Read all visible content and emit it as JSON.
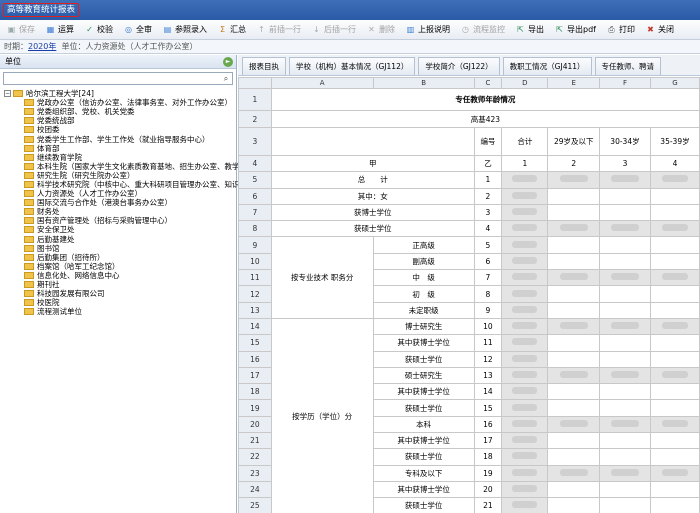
{
  "window": {
    "title": "高等教育统计报表"
  },
  "toolbar": {
    "buttons": [
      {
        "label": "保存",
        "icon": "save-icon",
        "disabled": true
      },
      {
        "label": "运算",
        "icon": "calculate-icon",
        "disabled": false
      },
      {
        "label": "校验",
        "icon": "check-icon",
        "disabled": false
      },
      {
        "label": "全审",
        "icon": "review-all-icon",
        "disabled": false
      },
      {
        "label": "参照录入",
        "icon": "reference-entry-icon",
        "disabled": false
      },
      {
        "label": "汇总",
        "icon": "summary-icon",
        "disabled": false
      },
      {
        "label": "前插一行",
        "icon": "insert-before-icon",
        "disabled": true
      },
      {
        "label": "后插一行",
        "icon": "insert-after-icon",
        "disabled": true
      },
      {
        "label": "删除",
        "icon": "delete-icon",
        "disabled": true
      },
      {
        "label": "上报说明",
        "icon": "report-note-icon",
        "disabled": false
      },
      {
        "label": "流程监控",
        "icon": "process-monitor-icon",
        "disabled": true
      },
      {
        "label": "导出",
        "icon": "export-icon",
        "disabled": false
      },
      {
        "label": "导出pdf",
        "icon": "export-pdf-icon",
        "disabled": false
      },
      {
        "label": "打印",
        "icon": "print-icon",
        "disabled": false
      },
      {
        "label": "关闭",
        "icon": "close-icon",
        "disabled": false
      }
    ]
  },
  "infobar": {
    "period_label": "时期：",
    "period_value": "2020年",
    "unit_label": "单位：",
    "unit_value": "人力资源处（人才工作办公室）"
  },
  "leftpanel": {
    "header": "单位",
    "search_value": "",
    "root_label": "哈尔滨工程大学[24]",
    "items": [
      "党政办公室（信访办公室、法律事务室、对外工作办公室）",
      "党委组织部、党校、机关党委",
      "党委统战部",
      "校团委",
      "党委学生工作部、学生工作处（就业指导服务中心）",
      "体育部",
      "继续教育学院",
      "本科生院（国家大学生文化素质教育基地、招生办公室、教学",
      "研究生院（研究生院办公室）",
      "科学技术研究院（中核中心、重大科研项目管理办公室、知识",
      "人力资源处（人才工作办公室）",
      "国际交流与合作处（港澳台事务办公室）",
      "财务处",
      "国有资产管理处（招标与采购管理中心）",
      "安全保卫处",
      "后勤基建处",
      "图书馆",
      "后勤集团（招待所）",
      "档案馆（哈军工纪念馆）",
      "信息化处、网络信息中心",
      "期刊社",
      "科技园发展有限公司",
      "校医院",
      "流程测试单位"
    ]
  },
  "tabs": [
    "报表目执",
    "学校（机构）基本情况（GJ112）",
    "学校简介（GJ122）",
    "教职工情况（GJ411）",
    "专任教师、聘请"
  ],
  "sheet": {
    "col_headers": [
      "A",
      "B",
      "C",
      "D",
      "E",
      "F",
      "G"
    ],
    "title": "专任教师年龄情况",
    "form_code": "高基423",
    "header_row": {
      "number": "编号",
      "total": "合计",
      "age1": "29岁及以下",
      "age2": "30-34岁",
      "age3": "35-39岁"
    },
    "code_row": {
      "a": "甲",
      "c": "乙",
      "d": "1",
      "e": "2",
      "f": "3",
      "g": "4"
    },
    "group_title": "按专业技术 职务分",
    "group_edu": "按学历（学位）分",
    "rows": [
      {
        "n": "5",
        "label": "总　　计",
        "code": "1"
      },
      {
        "n": "6",
        "label": "其中：女",
        "code": "2"
      },
      {
        "n": "7",
        "label": "获博士学位",
        "code": "3"
      },
      {
        "n": "8",
        "label": "获硕士学位",
        "code": "4"
      },
      {
        "n": "9",
        "label": "正高级",
        "code": "5"
      },
      {
        "n": "10",
        "label": "副高级",
        "code": "6"
      },
      {
        "n": "11",
        "label": "中　级",
        "code": "7"
      },
      {
        "n": "12",
        "label": "初　级",
        "code": "8"
      },
      {
        "n": "13",
        "label": "未定职级",
        "code": "9"
      },
      {
        "n": "14",
        "label": "博士研究生",
        "code": "10"
      },
      {
        "n": "15",
        "label": "其中获博士学位",
        "code": "11"
      },
      {
        "n": "16",
        "label": "获硕士学位",
        "code": "12"
      },
      {
        "n": "17",
        "label": "硕士研究生",
        "code": "13"
      },
      {
        "n": "18",
        "label": "其中获博士学位",
        "code": "14"
      },
      {
        "n": "19",
        "label": "获硕士学位",
        "code": "15"
      },
      {
        "n": "20",
        "label": "本科",
        "code": "16"
      },
      {
        "n": "21",
        "label": "其中获博士学位",
        "code": "17"
      },
      {
        "n": "22",
        "label": "获硕士学位",
        "code": "18"
      },
      {
        "n": "23",
        "label": "专科及以下",
        "code": "19"
      },
      {
        "n": "24",
        "label": "其中获博士学位",
        "code": "20"
      },
      {
        "n": "25",
        "label": "获硕士学位",
        "code": "21"
      }
    ],
    "row_numbers_top": [
      "1",
      "2",
      "3",
      "4"
    ]
  },
  "colors": {
    "titlebar": "#2b5aa6",
    "highlight": "#e02020",
    "folder": "#f0c44c"
  }
}
